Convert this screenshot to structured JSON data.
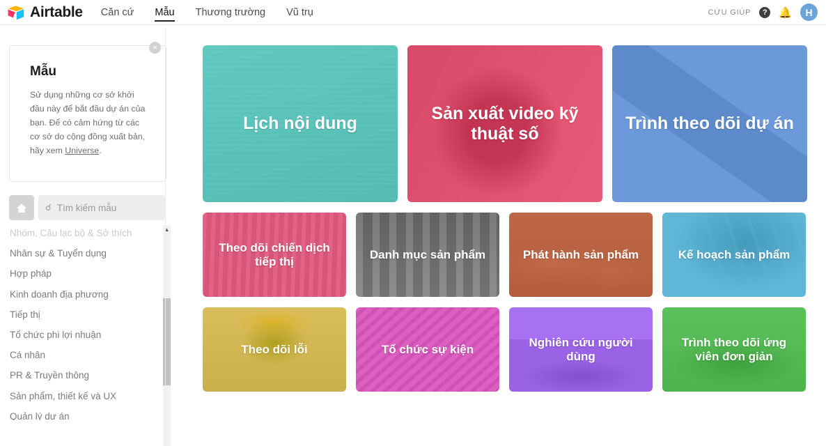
{
  "header": {
    "brand": "Airtable",
    "nav": [
      {
        "label": "Căn cứ",
        "active": false
      },
      {
        "label": "Mẫu",
        "active": true
      },
      {
        "label": "Thương trường",
        "active": false
      },
      {
        "label": "Vũ trụ",
        "active": false
      }
    ],
    "help_label": "CỨU GIÚP",
    "help_icon": "question-mark-icon",
    "bell_icon": "bell-icon",
    "avatar_initial": "H",
    "avatar_color": "#6ba5d7"
  },
  "sidebar": {
    "info_card": {
      "title": "Mẫu",
      "body_before_link": "Sử dụng những cơ sở khởi đầu này để bắt đầu dự án của bạn. Để có cảm hứng từ các cơ sở do cộng đồng xuất bản, hãy xem ",
      "link_text": "Universe",
      "body_after_link": ".",
      "close_icon": "×"
    },
    "home_icon": "home-icon",
    "search": {
      "icon": "search-icon",
      "placeholder": "Tìm kiếm mẫu",
      "value": ""
    },
    "categories": [
      "Nhóm, Câu lạc bộ & Sở thích",
      "Nhân sự & Tuyển dụng",
      "Hợp pháp",
      "Kinh doanh địa phương",
      "Tiếp thị",
      "Tổ chức phi lợi nhuận",
      "Cá nhân",
      "PR & Truyền thông",
      "Sản phẩm, thiết kế và UX",
      "Quản lý dự án"
    ],
    "scroll_up_icon": "▲"
  },
  "main": {
    "featured": [
      {
        "title": "Lịch nội dung",
        "color": "#27b5aa",
        "photo": "ph-desk"
      },
      {
        "title": "Sản xuất video kỹ thuật số",
        "color": "#e0143f",
        "photo": "ph-cam"
      },
      {
        "title": "Trình theo dõi dự án",
        "color": "#2d6ecb",
        "photo": "ph-table"
      }
    ],
    "templates_row1": [
      {
        "title": "Theo dõi chiến dịch tiếp thị",
        "color": "#d6184b",
        "photo": "ph-city"
      },
      {
        "title": "Danh mục sản phẩm",
        "color": "#494949",
        "photo": "ph-shelf"
      },
      {
        "title": "Phát hành sản phẩm",
        "color": "#bb3f10",
        "photo": "ph-smoke"
      },
      {
        "title": "Kế hoạch sản phẩm",
        "color": "#1593c4",
        "photo": "ph-track"
      }
    ],
    "templates_row2": [
      {
        "title": "Theo dõi lỗi",
        "color": "#d3a400",
        "photo": "ph-bug"
      },
      {
        "title": "Tổ chức sự kiện",
        "color": "#cc13a4",
        "photo": "ph-pixels"
      },
      {
        "title": "Nghiên cứu người dùng",
        "color": "#8335ee",
        "photo": "ph-room"
      },
      {
        "title": "Trình theo dõi ứng viên đơn giản",
        "color": "#1da81d",
        "photo": "ph-field"
      }
    ]
  }
}
